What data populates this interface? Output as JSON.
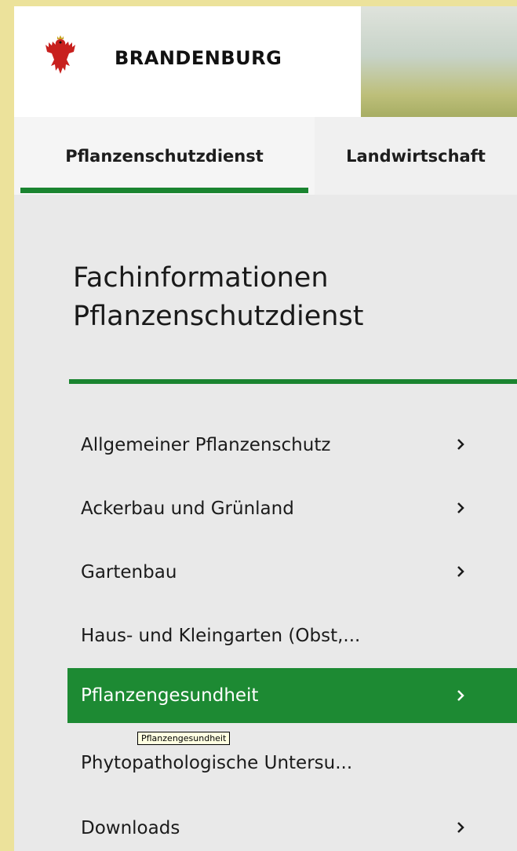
{
  "header": {
    "brand": "BRANDENBURG"
  },
  "tabs": [
    {
      "label": "Pflanzenschutzdienst",
      "active": true
    },
    {
      "label": "Landwirtschaft",
      "active": false
    }
  ],
  "section": {
    "title": "Fachinformationen Pflanzenschutzdienst"
  },
  "menu": [
    {
      "label": "Allgemeiner Pflanzenschutz",
      "chevron": true
    },
    {
      "label": "Ackerbau und Grünland",
      "chevron": true
    },
    {
      "label": "Gartenbau",
      "chevron": true
    },
    {
      "label": "Haus- und Kleingarten (Obst,...",
      "chevron": false
    },
    {
      "label": "Pflanzengesundheit",
      "chevron": true,
      "active": true
    },
    {
      "label": "Phytopathologische Untersu...",
      "chevron": false
    },
    {
      "label": "Downloads",
      "chevron": true
    }
  ],
  "tooltip": {
    "text": "Pflanzengesundheit"
  },
  "colors": {
    "accent": "#1a8430",
    "active_bg": "#1d8a33",
    "page_bg": "#e9e9e9",
    "outer_bg": "#ece29b"
  }
}
